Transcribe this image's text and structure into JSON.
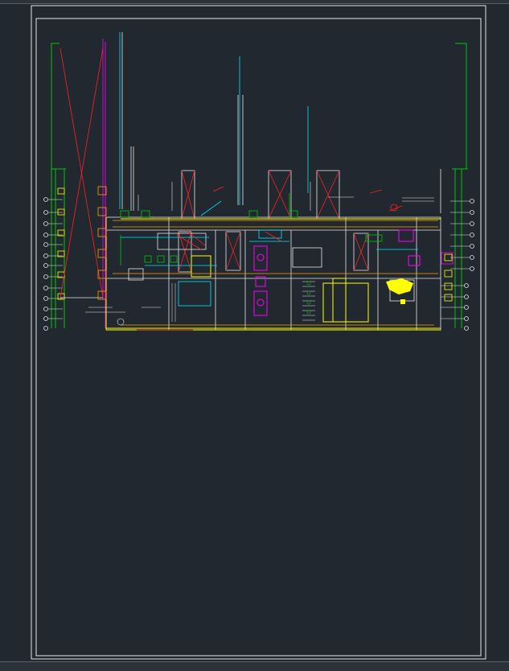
{
  "viewport": {
    "background": "#212830",
    "sheet_frame_color": "#e6e6e6"
  },
  "drawing": {
    "layer_colors": {
      "outline": "#ffffff",
      "grid": "#00c800",
      "cross": "#ff2020",
      "accent": "#ff00ff",
      "services": "#00e5ff",
      "walls": "#ffff00",
      "pipes": "#ffa000"
    },
    "icons": {
      "sheet_frame": "rectangle",
      "axis_bubble": "circle",
      "leader_line": "line"
    }
  }
}
